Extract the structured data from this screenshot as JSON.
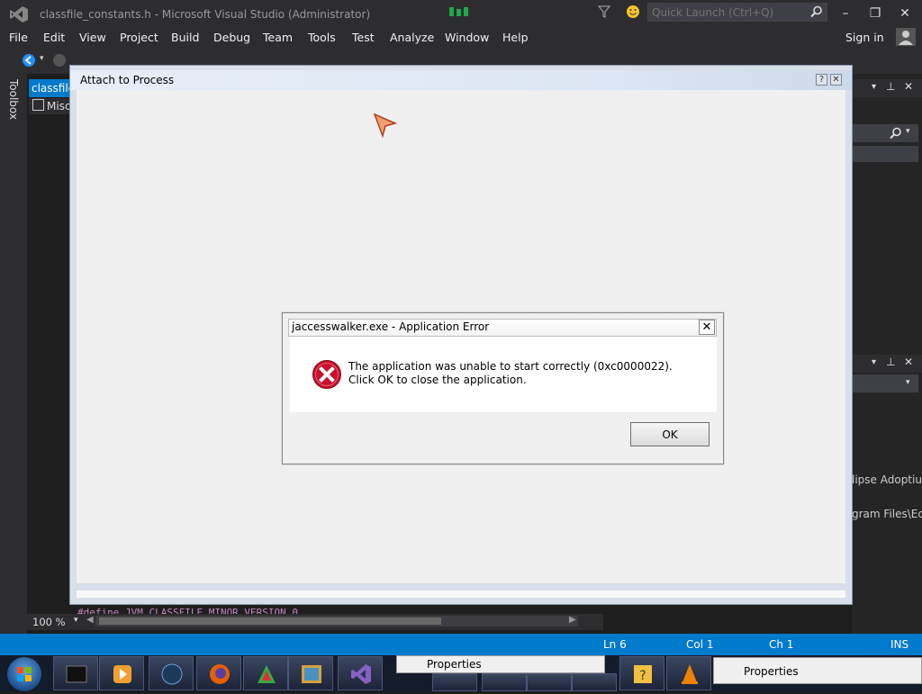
{
  "window": {
    "title": "classfile_constants.h - Microsoft Visual Studio (Administrator)",
    "quick_launch_placeholder": "Quick Launch (Ctrl+Q)"
  },
  "menu": {
    "items": [
      "File",
      "Edit",
      "View",
      "Project",
      "Build",
      "Debug",
      "Team",
      "Tools",
      "Test",
      "Analyze",
      "Window",
      "Help"
    ],
    "sign_in": "Sign in"
  },
  "toolbox": {
    "label": "Toolbox"
  },
  "editor": {
    "tab_label": "classfile",
    "misc_label": "Misc",
    "zoom": "100 %",
    "code_peek": "#define JVM_CLASSFILE_MINOR_VERSION 0"
  },
  "right_panel": {
    "text_1": "lipse Adoptiu",
    "text_2": "gram Files\\Ec"
  },
  "status": {
    "ln": "Ln 6",
    "col": "Col 1",
    "ch": "Ch 1",
    "mode": "INS"
  },
  "attach_dialog": {
    "title": "Attach to Process",
    "help": "?",
    "close": "✕"
  },
  "error_dialog": {
    "title": "jaccesswalker.exe - Application Error",
    "message": "The application was unable to start correctly (0xc0000022). Click OK to close the application.",
    "ok": "OK",
    "close": "✕"
  },
  "taskbar": {
    "popup_1": "Properties",
    "popup_2": "Properties",
    "buttons": [
      "terminal-icon",
      "media-player-icon",
      "globe-icon",
      "firefox-icon",
      "paint-icon",
      "image-viewer-icon",
      "visual-studio-icon",
      "app-icon",
      "app-icon",
      "app-icon",
      "app-icon",
      "help-icon",
      "vlc-icon"
    ]
  },
  "colors": {
    "accent": "#007acc",
    "chrome": "#2d2d30",
    "editor_bg": "#1e1e1e",
    "error_red": "#c8102e"
  }
}
